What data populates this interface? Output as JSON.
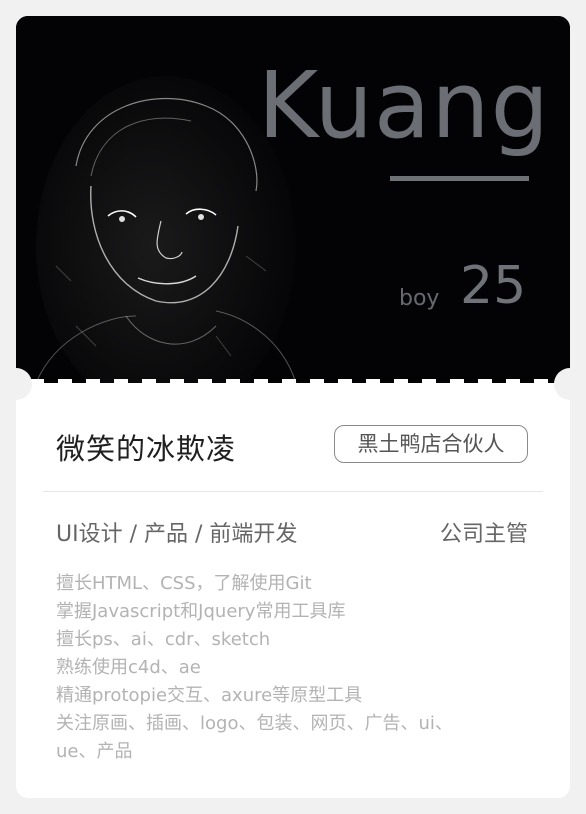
{
  "profile": {
    "name_en": "Kuang",
    "gender": "boy",
    "age": "25",
    "name_cn": "微笑的冰欺凌",
    "badge": "黑土鸭店合伙人",
    "skills": "UI设计 / 产品 / 前端开发",
    "role": "公司主管",
    "description": [
      "擅长HTML、CSS，了解使用Git",
      "掌握Javascript和Jquery常用工具库",
      "擅长ps、ai、cdr、sketch",
      "熟练使用c4d、ae",
      "精通protopie交互、axure等原型工具",
      "关注原画、插画、logo、包装、网页、广告、ui、",
      "ue、产品"
    ]
  },
  "colors": {
    "hero_bg": "#030305",
    "name_text": "#6b6f75",
    "card_bg": "#ffffff",
    "page_bg": "#f1f1f1"
  }
}
